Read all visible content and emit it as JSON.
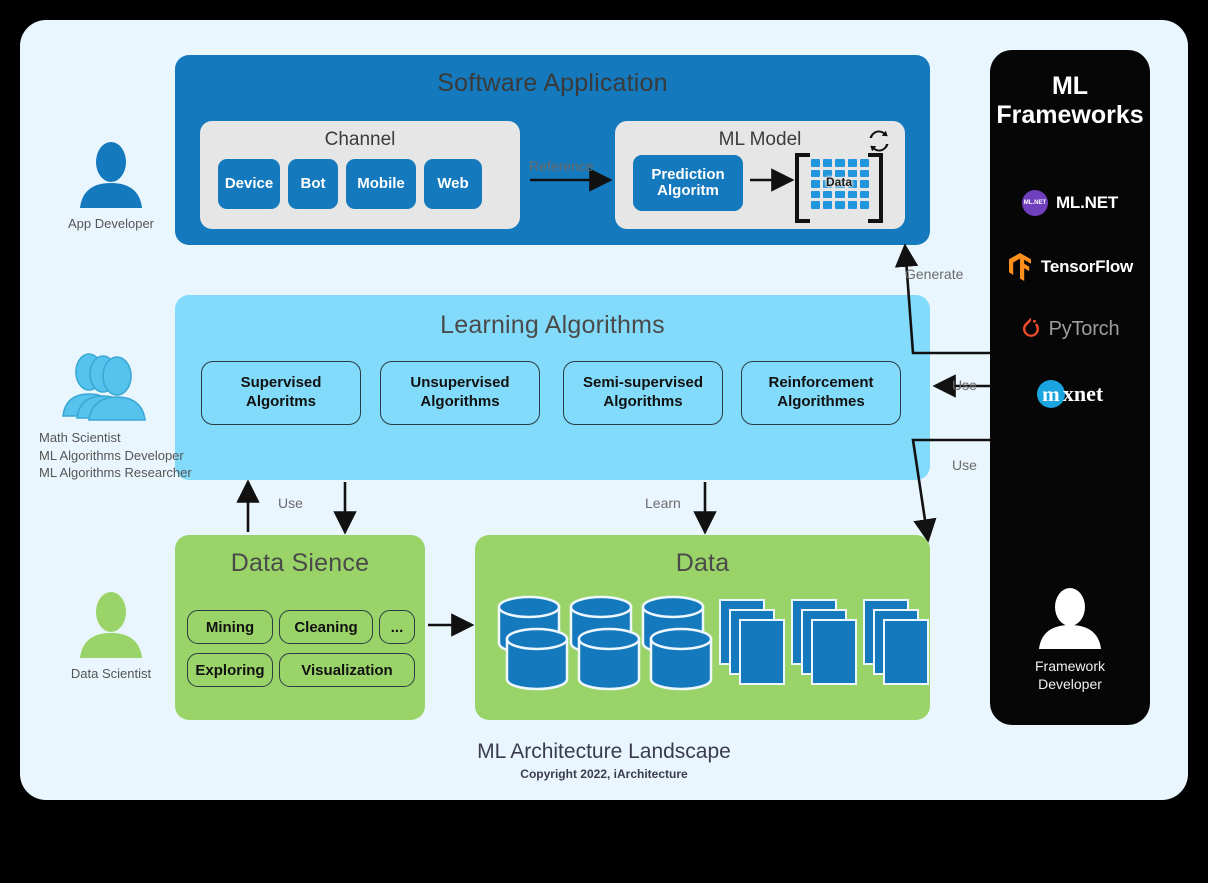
{
  "diagram": {
    "title": "ML Architecture Landscape",
    "copyright": "Copyright 2022, iArchitecture",
    "colors": {
      "canvas": "#eaf6fd",
      "software_application": "#1479bd",
      "learning_algorithms": "#83dbfb",
      "data_green": "#9ad469",
      "frameworks_panel": "#060606",
      "inner_card": "#e6e6e6"
    }
  },
  "software_application": {
    "title": "Software Application",
    "channel": {
      "title": "Channel",
      "items": [
        "Device",
        "Bot",
        "Mobile",
        "Web"
      ]
    },
    "ml_model": {
      "title": "ML Model",
      "prediction": "Prediction\nAlgoritm",
      "prediction_line1": "Prediction",
      "prediction_line2": "Algoritm",
      "matrix_label": "Data",
      "sync_icon": "refresh-sync-icon"
    },
    "reference_arrow_label": "Reference"
  },
  "learning_algorithms": {
    "title": "Learning Algorithms",
    "items": [
      {
        "line1": "Supervised",
        "line2": "Algoritms"
      },
      {
        "line1": "Unsupervised",
        "line2": "Algorithms"
      },
      {
        "line1": "Semi-supervised",
        "line2": "Algorithms"
      },
      {
        "line1": "Reinforcement",
        "line2": "Algorithmes"
      }
    ]
  },
  "data_science": {
    "title": "Data Sience",
    "items": [
      "Mining",
      "Cleaning",
      "...",
      "Exploring",
      "Visualization"
    ]
  },
  "data_section": {
    "title": "Data",
    "database_count": 3,
    "document_stack_count": 3
  },
  "frameworks": {
    "title_line1": "ML",
    "title_line2": "Frameworks",
    "items": [
      {
        "name": "ML.NET",
        "badge": "ML.NET",
        "color": "#6f3fbd"
      },
      {
        "name": "TensorFlow",
        "color": "#ff8f1c"
      },
      {
        "name": "PyTorch",
        "color": "#ee4c2c"
      },
      {
        "name": "mxnet",
        "badge_letter": "m",
        "rest": "xnet",
        "color": "#1aa4e0"
      }
    ],
    "developer": {
      "line1": "Framework",
      "line2": "Developer",
      "icon": "person-icon"
    }
  },
  "personas": [
    {
      "id": "app-developer",
      "lines": [
        "App Developer"
      ],
      "color": "#1479bd",
      "icon": "person-icon"
    },
    {
      "id": "math-scientist",
      "lines": [
        "Math Scientist",
        "ML Algorithms Developer",
        "ML Algorithms Researcher"
      ],
      "color": "#55c3ee",
      "icon": "people-group-icon"
    },
    {
      "id": "data-scientist",
      "lines": [
        "Data Scientist"
      ],
      "color": "#9ad469",
      "icon": "person-icon"
    }
  ],
  "arrows": [
    {
      "id": "reference",
      "label": "Reference"
    },
    {
      "id": "generate",
      "label": "Generate"
    },
    {
      "id": "use-frameworks-learning",
      "label": "Use"
    },
    {
      "id": "use-frameworks-data",
      "label": "Use"
    },
    {
      "id": "use-datascience-learning",
      "label": "Use"
    },
    {
      "id": "learn",
      "label": "Learn"
    }
  ]
}
